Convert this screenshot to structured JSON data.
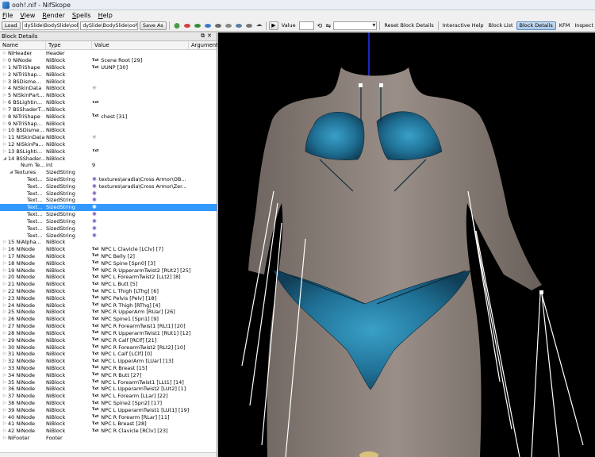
{
  "window": {
    "title": "ooh!.nif - NifSkope"
  },
  "menu": [
    {
      "key": "F",
      "rest": "ile"
    },
    {
      "key": "V",
      "rest": "iew"
    },
    {
      "key": "R",
      "rest": "ender"
    },
    {
      "key": "S",
      "rest": "pells"
    },
    {
      "key": "H",
      "rest": "elp"
    }
  ],
  "toolbar": {
    "load_label": "Load",
    "load_path": "dySlide\\BodySlide\\ooh!.nif",
    "save_path": "dySlide\\BodySlide\\ooh!.nif",
    "save_as_label": "Save As",
    "value_label": "Value",
    "reset_block_details": "Reset Block Details",
    "interactive_help": "Interactive Help",
    "block_list": "Block List",
    "block_details": "Block Details",
    "kfm": "KFM",
    "inspect": "Inspect"
  },
  "panel": {
    "title": "Block Details",
    "columns": [
      "Name",
      "Type",
      "Value",
      "Argument"
    ],
    "rows": [
      {
        "name": "NiHeader",
        "type": "Header",
        "value": "",
        "tag": "",
        "indent": 0,
        "arrow": "▷"
      },
      {
        "name": "0 NiNode",
        "type": "NiBlock",
        "value": "Scene Root [29]",
        "tag": "txt",
        "indent": 0,
        "arrow": "▷"
      },
      {
        "name": "1 NiTriShape",
        "type": "NiBlock",
        "value": "UUNP [30]",
        "tag": "txt",
        "indent": 0,
        "arrow": "▷"
      },
      {
        "name": "2 NiTriShap...",
        "type": "NiBlock",
        "value": "",
        "tag": "",
        "indent": 0,
        "arrow": "▷"
      },
      {
        "name": "3 BSDisme...",
        "type": "NiBlock",
        "value": "",
        "tag": "",
        "indent": 0,
        "arrow": "▷"
      },
      {
        "name": "4 NiSkinData",
        "type": "NiBlock",
        "value": "",
        "tag": "gear",
        "indent": 0,
        "arrow": "▷"
      },
      {
        "name": "5 NiSkinPart...",
        "type": "NiBlock",
        "value": "",
        "tag": "",
        "indent": 0,
        "arrow": "▷"
      },
      {
        "name": "6 BSLightin...",
        "type": "NiBlock",
        "value": "",
        "tag": "txt",
        "indent": 0,
        "arrow": "▷"
      },
      {
        "name": "7 BSShaderT...",
        "type": "NiBlock",
        "value": "",
        "tag": "",
        "indent": 0,
        "arrow": "▷"
      },
      {
        "name": "8 NiTriShape",
        "type": "NiBlock",
        "value": "chest [31]",
        "tag": "txt",
        "indent": 0,
        "arrow": "▷"
      },
      {
        "name": "9 NiTriShap...",
        "type": "NiBlock",
        "value": "",
        "tag": "",
        "indent": 0,
        "arrow": "▷"
      },
      {
        "name": "10 BSDisme...",
        "type": "NiBlock",
        "value": "",
        "tag": "",
        "indent": 0,
        "arrow": "▷"
      },
      {
        "name": "11 NiSkinData",
        "type": "NiBlock",
        "value": "",
        "tag": "gear",
        "indent": 0,
        "arrow": "▷"
      },
      {
        "name": "12 NiSkinPa...",
        "type": "NiBlock",
        "value": "",
        "tag": "",
        "indent": 0,
        "arrow": "▷"
      },
      {
        "name": "13 BSLighti...",
        "type": "NiBlock",
        "value": "",
        "tag": "txt",
        "indent": 0,
        "arrow": "▷"
      },
      {
        "name": "14 BSShader...",
        "type": "NiBlock",
        "value": "",
        "tag": "",
        "indent": 0,
        "arrow": "◢"
      },
      {
        "name": "Num Te...",
        "type": "int",
        "value": "9",
        "tag": "",
        "indent": 2,
        "arrow": ""
      },
      {
        "name": "Textures",
        "type": "SizedString",
        "value": "",
        "tag": "",
        "indent": 1,
        "arrow": "◢"
      },
      {
        "name": "Text...",
        "type": "SizedString",
        "value": "textures\\aradia\\Cross Armor\\OB...",
        "tag": "star",
        "indent": 3,
        "arrow": ""
      },
      {
        "name": "Text...",
        "type": "SizedString",
        "value": "textures\\aradia\\Cross Armor\\Zer...",
        "tag": "star",
        "indent": 3,
        "arrow": ""
      },
      {
        "name": "Text...",
        "type": "SizedString",
        "value": "",
        "tag": "star",
        "indent": 3,
        "arrow": ""
      },
      {
        "name": "Text...",
        "type": "SizedString",
        "value": "",
        "tag": "star",
        "indent": 3,
        "arrow": ""
      },
      {
        "name": "Text...",
        "type": "SizedString",
        "value": "",
        "tag": "star",
        "indent": 3,
        "arrow": "",
        "selected": true
      },
      {
        "name": "Text...",
        "type": "SizedString",
        "value": "",
        "tag": "star",
        "indent": 3,
        "arrow": ""
      },
      {
        "name": "Text...",
        "type": "SizedString",
        "value": "",
        "tag": "star",
        "indent": 3,
        "arrow": ""
      },
      {
        "name": "Text...",
        "type": "SizedString",
        "value": "",
        "tag": "star",
        "indent": 3,
        "arrow": ""
      },
      {
        "name": "Text...",
        "type": "SizedString",
        "value": "",
        "tag": "star",
        "indent": 3,
        "arrow": ""
      },
      {
        "name": "15 NiAlpha...",
        "type": "NiBlock",
        "value": "",
        "tag": "",
        "indent": 0,
        "arrow": "▷"
      },
      {
        "name": "16 NiNode",
        "type": "NiBlock",
        "value": "NPC L Clavicle [LClv] [7]",
        "tag": "txt",
        "indent": 0,
        "arrow": "▷"
      },
      {
        "name": "17 NiNode",
        "type": "NiBlock",
        "value": "NPC Belly [2]",
        "tag": "txt",
        "indent": 0,
        "arrow": "▷"
      },
      {
        "name": "18 NiNode",
        "type": "NiBlock",
        "value": "NPC Spine [Spn0] [3]",
        "tag": "txt",
        "indent": 0,
        "arrow": "▷"
      },
      {
        "name": "19 NiNode",
        "type": "NiBlock",
        "value": "NPC R UpperarmTwist2 [RUt2] [25]",
        "tag": "txt",
        "indent": 0,
        "arrow": "▷"
      },
      {
        "name": "20 NiNode",
        "type": "NiBlock",
        "value": "NPC L ForearmTwist2 [LLt2] [8]",
        "tag": "txt",
        "indent": 0,
        "arrow": "▷"
      },
      {
        "name": "21 NiNode",
        "type": "NiBlock",
        "value": "NPC L Butt [5]",
        "tag": "txt",
        "indent": 0,
        "arrow": "▷"
      },
      {
        "name": "22 NiNode",
        "type": "NiBlock",
        "value": "NPC L Thigh [LThg] [6]",
        "tag": "txt",
        "indent": 0,
        "arrow": "▷"
      },
      {
        "name": "23 NiNode",
        "type": "NiBlock",
        "value": "NPC Pelvis [Pelv] [18]",
        "tag": "txt",
        "indent": 0,
        "arrow": "▷"
      },
      {
        "name": "24 NiNode",
        "type": "NiBlock",
        "value": "NPC R Thigh [RThg] [4]",
        "tag": "txt",
        "indent": 0,
        "arrow": "▷"
      },
      {
        "name": "25 NiNode",
        "type": "NiBlock",
        "value": "NPC R UpperArm [RUar] [26]",
        "tag": "txt",
        "indent": 0,
        "arrow": "▷"
      },
      {
        "name": "26 NiNode",
        "type": "NiBlock",
        "value": "NPC Spine1 [Spn1] [9]",
        "tag": "txt",
        "indent": 0,
        "arrow": "▷"
      },
      {
        "name": "27 NiNode",
        "type": "NiBlock",
        "value": "NPC R ForearmTwist1 [RLt1] [20]",
        "tag": "txt",
        "indent": 0,
        "arrow": "▷"
      },
      {
        "name": "28 NiNode",
        "type": "NiBlock",
        "value": "NPC R UpperarmTwist1 [RUt1] [12]",
        "tag": "txt",
        "indent": 0,
        "arrow": "▷"
      },
      {
        "name": "29 NiNode",
        "type": "NiBlock",
        "value": "NPC R Calf [RClf] [21]",
        "tag": "txt",
        "indent": 0,
        "arrow": "▷"
      },
      {
        "name": "30 NiNode",
        "type": "NiBlock",
        "value": "NPC R ForearmTwist2 [RLt2] [10]",
        "tag": "txt",
        "indent": 0,
        "arrow": "▷"
      },
      {
        "name": "31 NiNode",
        "type": "NiBlock",
        "value": "NPC L Calf [LClf] [0]",
        "tag": "txt",
        "indent": 0,
        "arrow": "▷"
      },
      {
        "name": "32 NiNode",
        "type": "NiBlock",
        "value": "NPC L UpperArm [LUar] [13]",
        "tag": "txt",
        "indent": 0,
        "arrow": "▷"
      },
      {
        "name": "33 NiNode",
        "type": "NiBlock",
        "value": "NPC R Breast [15]",
        "tag": "txt",
        "indent": 0,
        "arrow": "▷"
      },
      {
        "name": "34 NiNode",
        "type": "NiBlock",
        "value": "NPC R Butt [27]",
        "tag": "txt",
        "indent": 0,
        "arrow": "▷"
      },
      {
        "name": "35 NiNode",
        "type": "NiBlock",
        "value": "NPC L ForearmTwist1 [LLt1] [14]",
        "tag": "txt",
        "indent": 0,
        "arrow": "▷"
      },
      {
        "name": "36 NiNode",
        "type": "NiBlock",
        "value": "NPC L UpperarmTwist2 [LUt2] [1]",
        "tag": "txt",
        "indent": 0,
        "arrow": "▷"
      },
      {
        "name": "37 NiNode",
        "type": "NiBlock",
        "value": "NPC L Forearm [LLar] [22]",
        "tag": "txt",
        "indent": 0,
        "arrow": "▷"
      },
      {
        "name": "38 NiNode",
        "type": "NiBlock",
        "value": "NPC Spine2 [Spn2] [17]",
        "tag": "txt",
        "indent": 0,
        "arrow": "▷"
      },
      {
        "name": "39 NiNode",
        "type": "NiBlock",
        "value": "NPC L UpperarmTwist1 [LUt1] [19]",
        "tag": "txt",
        "indent": 0,
        "arrow": "▷"
      },
      {
        "name": "40 NiNode",
        "type": "NiBlock",
        "value": "NPC R Forearm [RLar] [11]",
        "tag": "txt",
        "indent": 0,
        "arrow": "▷"
      },
      {
        "name": "41 NiNode",
        "type": "NiBlock",
        "value": "NPC L Breast [28]",
        "tag": "txt",
        "indent": 0,
        "arrow": "▷"
      },
      {
        "name": "42 NiNode",
        "type": "NiBlock",
        "value": "NPC R Clavicle [RClv] [23]",
        "tag": "txt",
        "indent": 0,
        "arrow": "▷"
      },
      {
        "name": "NiFooter",
        "type": "Footer",
        "value": "",
        "tag": "",
        "indent": 0,
        "arrow": "▷"
      }
    ]
  },
  "icons": {
    "tag_text": "Txt",
    "tag_gear": "✳",
    "tag_star": "✺"
  },
  "colors": {
    "selection": "#3399ff",
    "viewport_bg": "#000000",
    "skin": "#8b7f78",
    "garment": "#1f6f94",
    "axis": "#2233ff"
  }
}
